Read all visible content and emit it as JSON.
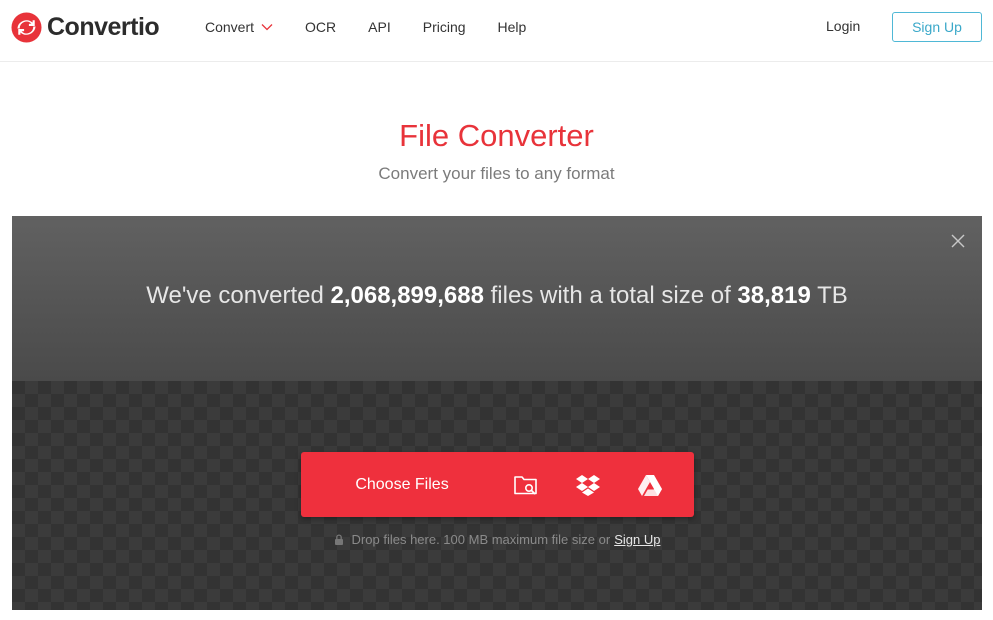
{
  "brand": {
    "name": "Convertio",
    "accent": "#e8333a"
  },
  "nav": {
    "items": [
      {
        "label": "Convert",
        "has_dropdown": true
      },
      {
        "label": "OCR"
      },
      {
        "label": "API"
      },
      {
        "label": "Pricing"
      },
      {
        "label": "Help"
      }
    ],
    "login": "Login",
    "signup": "Sign Up"
  },
  "hero": {
    "title": "File Converter",
    "subtitle": "Convert your files to any format"
  },
  "stats": {
    "prefix": "We've converted",
    "files_count": "2,068,899,688",
    "middle": "files with a total size of",
    "total_size": "38,819",
    "unit": "TB"
  },
  "upload": {
    "button_label": "Choose Files",
    "sources": [
      "folder-search-icon",
      "dropbox-icon",
      "google-drive-icon"
    ],
    "note": "Drop files here. 100 MB maximum file size or",
    "note_link": "Sign Up"
  }
}
